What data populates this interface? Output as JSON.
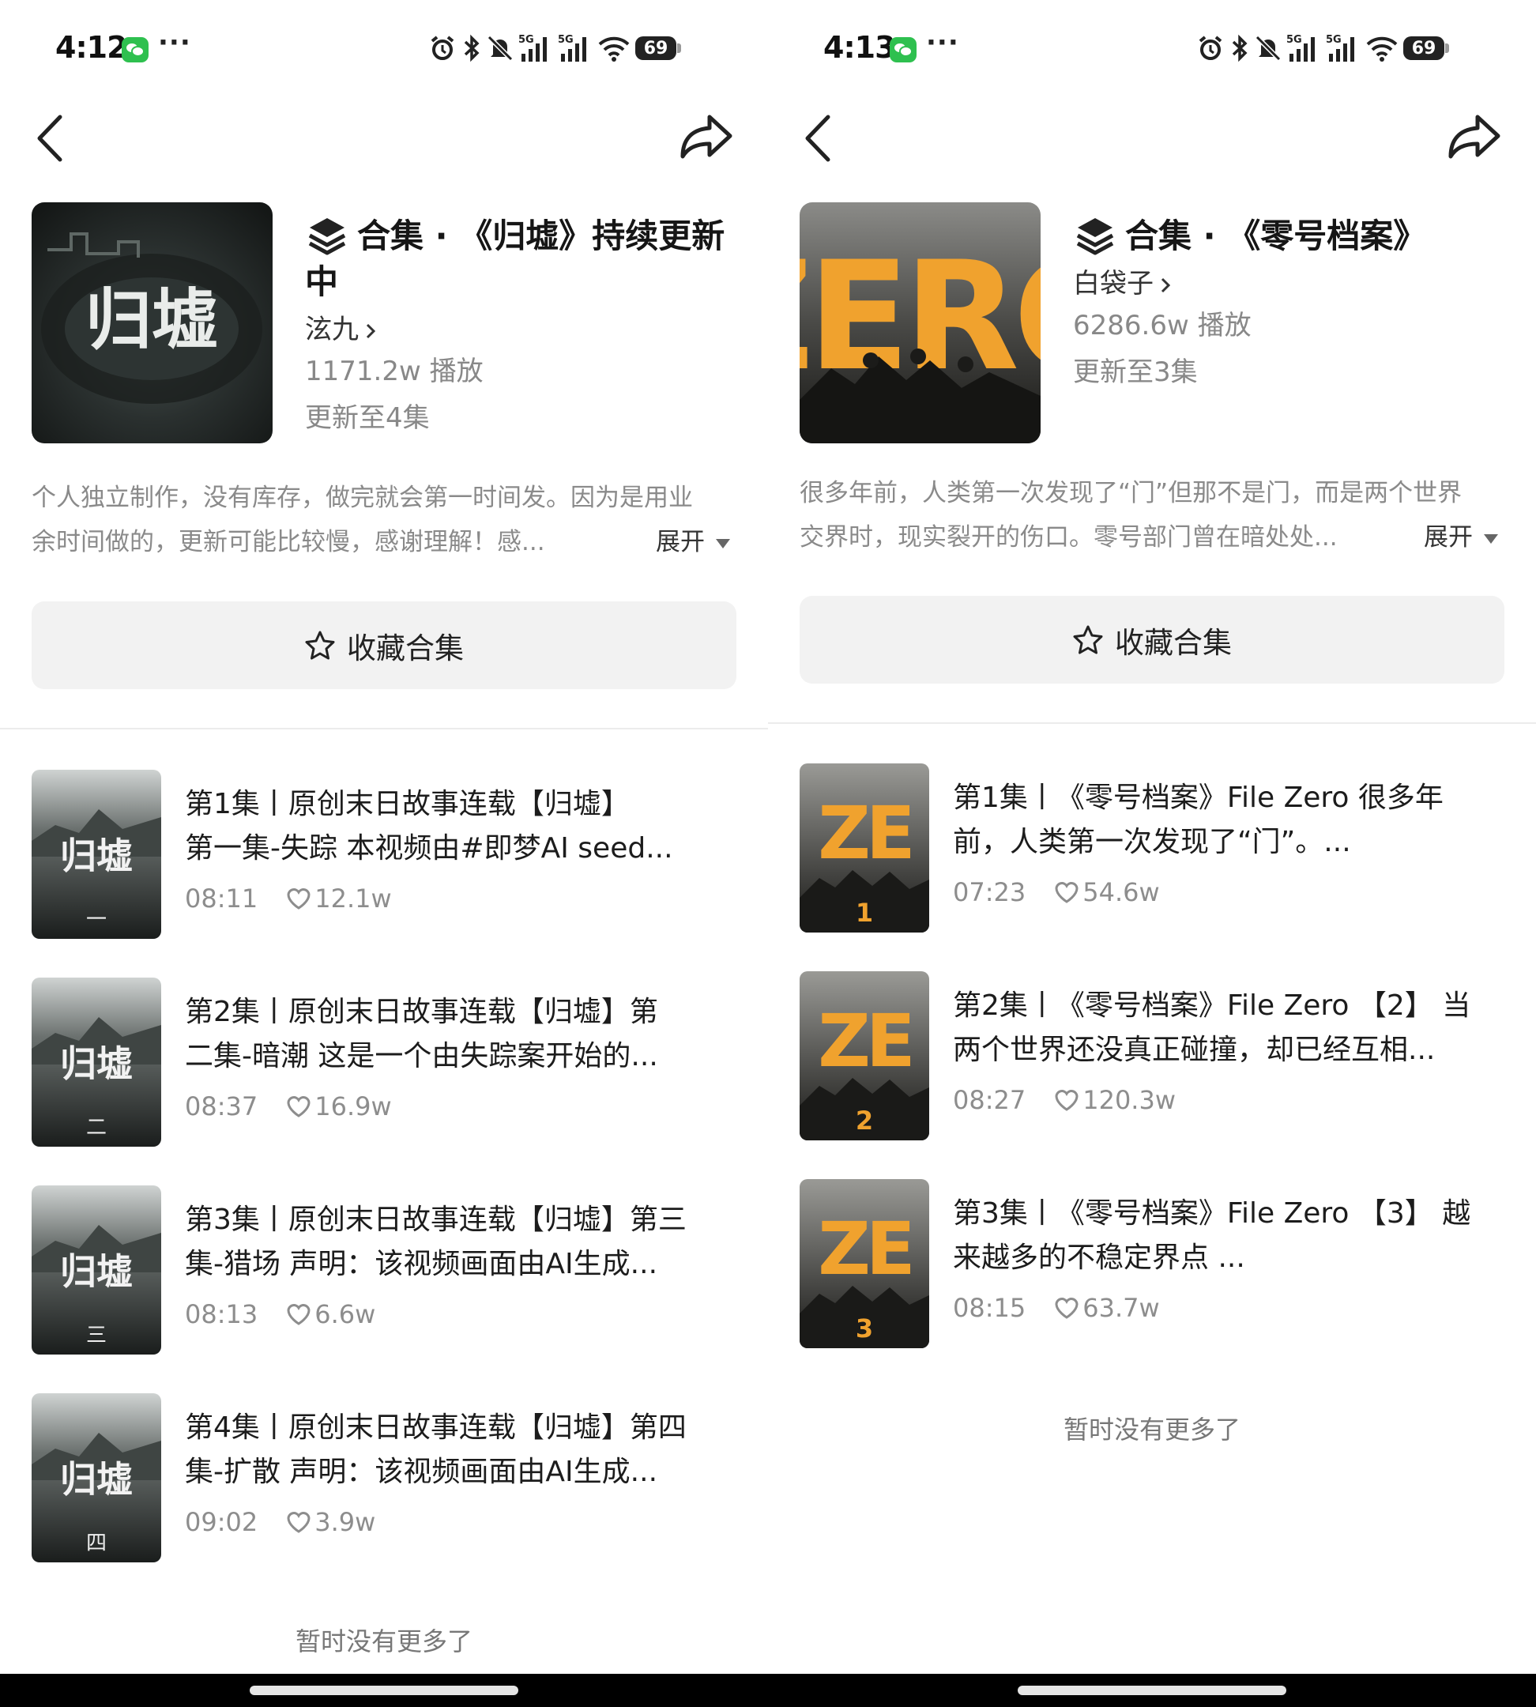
{
  "panels": [
    {
      "status": {
        "time": "4:12",
        "more": "···",
        "network": "5G",
        "battery": "69"
      },
      "collection": {
        "title_line1": "合集 · 《归墟》持续更新",
        "title_line2": "中",
        "cover_text": "归墟",
        "author": "泫九",
        "plays": "1171.2w 播放",
        "updated": "更新至4集",
        "desc_line1": "个人独立制作，没有库存，做完就会第一时间发。因为是用业",
        "desc_line2": "余时间做的，更新可能比较慢，感谢理解！感...",
        "expand_label": "展开",
        "favorite_label": "收藏合集"
      },
      "episodes": [
        {
          "line1": "第1集丨原创末日故事连载【归墟】",
          "line2": "第一集-失踪 本视频由#即梦AI  seed...",
          "duration": "08:11",
          "likes": "12.1w",
          "thumb_title": "归墟",
          "thumb_num": "一"
        },
        {
          "line1": "第2集丨原创末日故事连载【归墟】第",
          "line2": "二集-暗潮 这是一个由失踪案开始的...",
          "duration": "08:37",
          "likes": "16.9w",
          "thumb_title": "归墟",
          "thumb_num": "二"
        },
        {
          "line1": "第3集丨原创末日故事连载【归墟】第三",
          "line2": "集-猎场 声明：该视频画面由AI生成...",
          "duration": "08:13",
          "likes": "6.6w",
          "thumb_title": "归墟",
          "thumb_num": "三"
        },
        {
          "line1": "第4集丨原创末日故事连载【归墟】第四",
          "line2": "集-扩散 声明：该视频画面由AI生成...",
          "duration": "09:02",
          "likes": "3.9w",
          "thumb_title": "归墟",
          "thumb_num": "四"
        }
      ],
      "no_more": "暂时没有更多了"
    },
    {
      "status": {
        "time": "4:13",
        "more": "···",
        "network": "5G",
        "battery": "69"
      },
      "collection": {
        "title_line1": "合集 · 《零号档案》",
        "title_line2": "",
        "cover_text": "ZERO",
        "author": "白袋子",
        "plays": "6286.6w 播放",
        "updated": "更新至3集",
        "desc_line1": "很多年前，人类第一次发现了“门”但那不是门，而是两个世界",
        "desc_line2": "交界时，现实裂开的伤口。零号部门曾在暗处处...",
        "expand_label": "展开",
        "favorite_label": "收藏合集"
      },
      "episodes": [
        {
          "line1": "第1集丨《零号档案》File Zero 很多年",
          "line2": "前，人类第一次发现了“门”。...",
          "duration": "07:23",
          "likes": "54.6w",
          "thumb_title": "ZE",
          "thumb_num": "1"
        },
        {
          "line1": "第2集丨《零号档案》File Zero 【2】 当",
          "line2": "两个世界还没真正碰撞，却已经互相...",
          "duration": "08:27",
          "likes": "120.3w",
          "thumb_title": "ZE",
          "thumb_num": "2"
        },
        {
          "line1": "第3集丨《零号档案》File Zero 【3】 越",
          "line2": "来越多的不稳定界点 ...",
          "duration": "08:15",
          "likes": "63.7w",
          "thumb_title": "ZE",
          "thumb_num": "3"
        }
      ],
      "no_more": "暂时没有更多了"
    }
  ],
  "colors": {
    "accent_orange": "#f0a22e",
    "fav_bg": "#f2f2f2",
    "muted_text": "#8a8a8a",
    "wechat_green": "#2ec04f"
  }
}
